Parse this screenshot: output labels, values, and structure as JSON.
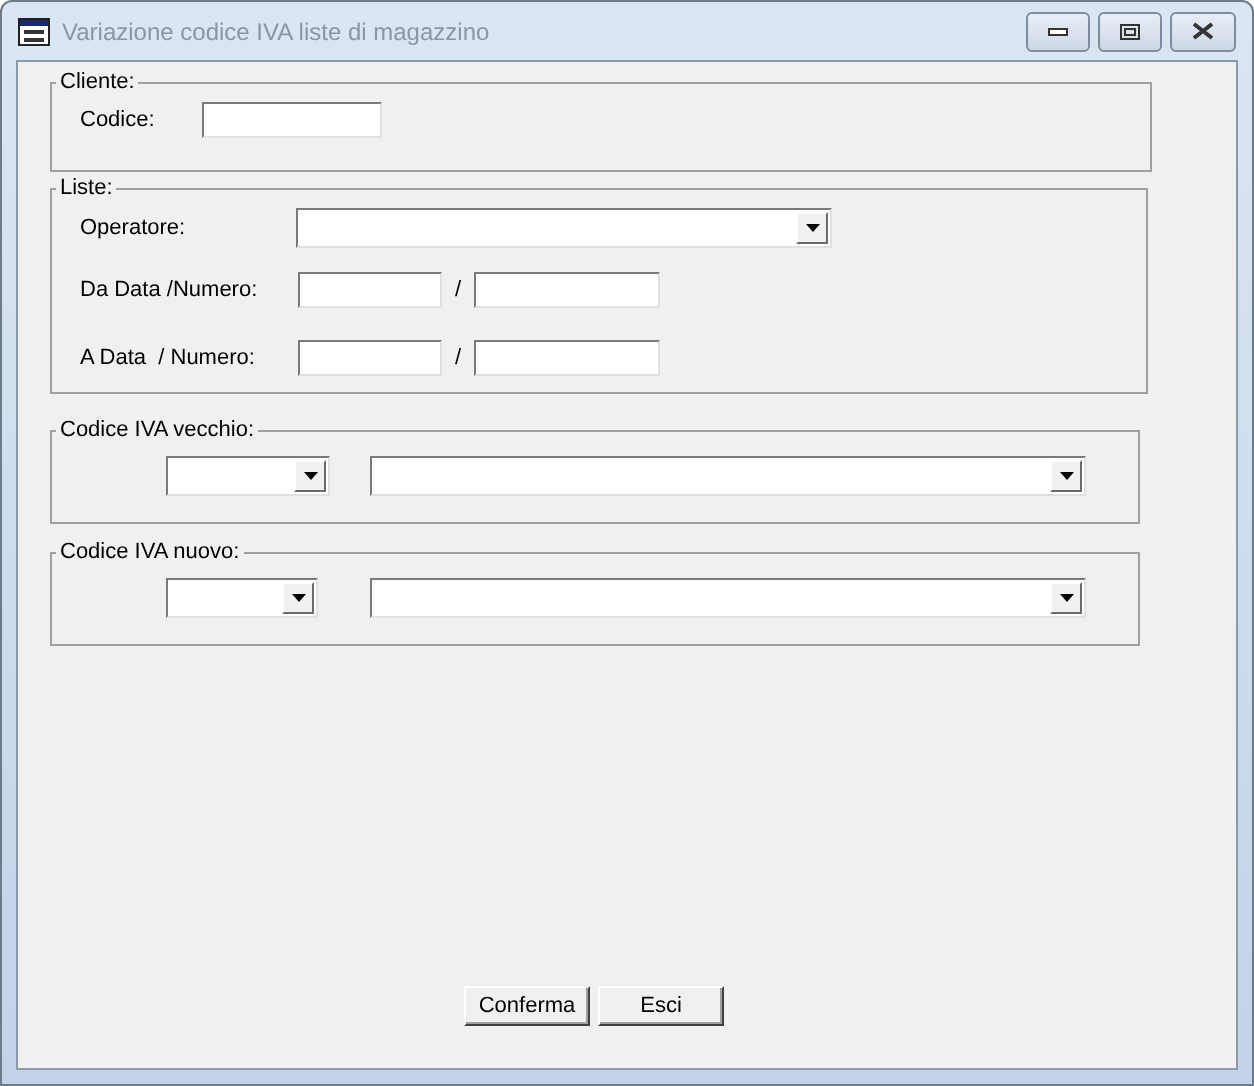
{
  "window": {
    "title": "Variazione codice IVA liste di magazzino"
  },
  "cliente": {
    "legend": "Cliente:",
    "codice_label": "Codice:"
  },
  "liste": {
    "legend": "Liste:",
    "operatore_label": "Operatore:",
    "rows": [
      {
        "label": "Da Data /Numero:",
        "separator": "/"
      },
      {
        "label": "A Data  / Numero:",
        "separator": "/"
      }
    ]
  },
  "iva_groups": [
    {
      "legend": "Codice IVA vecchio:"
    },
    {
      "legend": "Codice IVA nuovo:"
    }
  ],
  "buttons": [
    {
      "label": "Conferma"
    },
    {
      "label": "Esci"
    }
  ]
}
